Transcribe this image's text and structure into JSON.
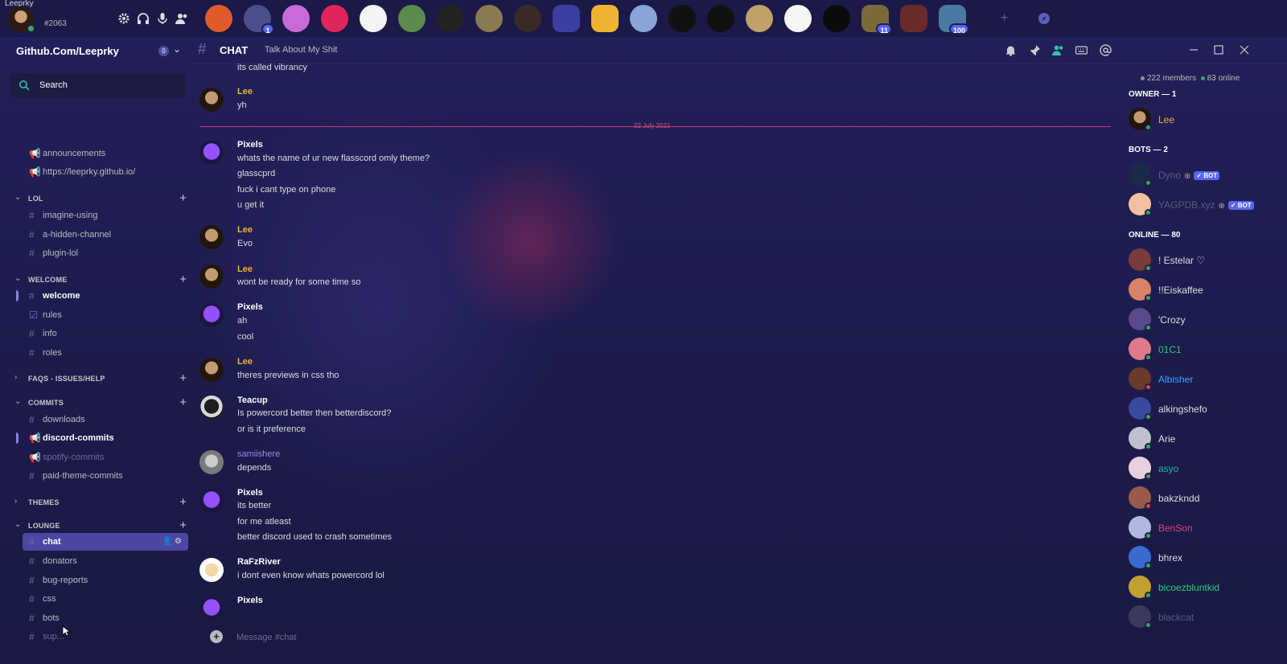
{
  "window": {
    "title": "Leeprky"
  },
  "user": {
    "discriminator": "#2063"
  },
  "servers": [
    {
      "name": "server-sunset",
      "color": "#e05b2b"
    },
    {
      "name": "server-city",
      "color": "#4a4e8a",
      "badge": "1"
    },
    {
      "name": "server-rainbow",
      "color": "#c86bd6"
    },
    {
      "name": "server-pink",
      "color": "#e2245c"
    },
    {
      "name": "server-goose",
      "color": "#f4f4f4"
    },
    {
      "name": "server-frog",
      "color": "#5c8a4a"
    },
    {
      "name": "server-vz",
      "color": "#222222"
    },
    {
      "name": "server-cat",
      "color": "#8a7a52"
    },
    {
      "name": "server-portrait",
      "color": "#3a2a26"
    },
    {
      "name": "server-folder-blue",
      "color": "#3b3f9e"
    },
    {
      "name": "server-folder-yellow",
      "color": "#f0b232"
    },
    {
      "name": "server-stripes",
      "color": "#8aa4d6"
    },
    {
      "name": "server-g1",
      "color": "#111111"
    },
    {
      "name": "server-g2",
      "color": "#111111"
    },
    {
      "name": "server-bird",
      "color": "#c2a06a"
    },
    {
      "name": "server-9l",
      "color": "#f5f5f5"
    },
    {
      "name": "server-binary",
      "color": "#0b0b0b"
    },
    {
      "name": "server-folder-11",
      "color": "#7a6a3a",
      "badge": "11"
    },
    {
      "name": "server-folder-red",
      "color": "#6a2a2a"
    },
    {
      "name": "server-folder-100",
      "color": "#4a7aa0",
      "badge": "100"
    }
  ],
  "sidebar": {
    "server_name": "Github.Com/Leeprky",
    "boost_count": "0",
    "search_label": "Search",
    "top_channels": [
      {
        "name": "announcements"
      },
      {
        "name": "https://leeprky.github.io/"
      }
    ],
    "categories": [
      {
        "name": "LOL",
        "channels": [
          "imagine-using",
          "a-hidden-channel",
          "plugin-lol"
        ]
      },
      {
        "name": "WELCOME",
        "channels": [
          "welcome",
          "rules",
          "info",
          "roles"
        ]
      },
      {
        "name": "FAQS - ISSUES/HELP",
        "channels": []
      },
      {
        "name": "COMMITS",
        "channels": [
          "downloads",
          "discord-commits",
          "spotify-commits",
          "paid-theme-commits"
        ]
      },
      {
        "name": "THEMES",
        "channels": []
      },
      {
        "name": "LOUNGE",
        "channels": [
          "chat",
          "donators",
          "bug-reports",
          "css",
          "bots",
          "sup..."
        ]
      }
    ]
  },
  "header": {
    "channel": "CHAT",
    "topic": "Talk About My Shit"
  },
  "chat": {
    "date_divider": "22 July 2021",
    "messages": [
      {
        "text": "its called vibrancy"
      },
      {
        "author": "Lee",
        "lines": [
          "yh"
        ]
      },
      {
        "author": "Pixels",
        "lines": [
          "whats the name of ur new flasscord omly theme?",
          "glasscprd",
          "fuck i cant type on phone",
          "u get it"
        ]
      },
      {
        "author": "Lee",
        "lines": [
          "Evo"
        ]
      },
      {
        "author": "Lee",
        "lines": [
          "wont be ready for some time so"
        ]
      },
      {
        "author": "Pixels",
        "lines": [
          "ah",
          "cool"
        ]
      },
      {
        "author": "Lee",
        "lines": [
          "theres previews in css tho"
        ]
      },
      {
        "author": "Teacup",
        "lines": [
          "Is powercord better then betterdiscord?",
          "or is it preference"
        ]
      },
      {
        "author": "samiishere",
        "lines": [
          "depends"
        ]
      },
      {
        "author": "Pixels",
        "lines": [
          "its better",
          "for me atleast",
          "better discord used to crash sometimes"
        ]
      },
      {
        "author": "RaFzRiver",
        "lines": [
          "i dont even know whats powercord lol"
        ]
      },
      {
        "author": "Pixels",
        "lines": []
      }
    ],
    "composer_placeholder": "Message #chat"
  },
  "members": {
    "total": "222 members",
    "online": "83 online",
    "groups": [
      {
        "title": "OWNER — 1",
        "members": [
          {
            "name": "Lee",
            "color": "#f0b232",
            "status": "online"
          }
        ]
      },
      {
        "title": "BOTS — 2",
        "members": [
          {
            "name": "Dyno",
            "color": "#5b5d80",
            "status": "online",
            "bot": "✓ BOT"
          },
          {
            "name": "YAGPDB.xyz",
            "color": "#5b5d80",
            "status": "online",
            "bot": "✓ BOT"
          }
        ]
      },
      {
        "title": "ONLINE — 80",
        "members": [
          {
            "name": "! Estelar ♡",
            "color": "#dcddde",
            "status": "online"
          },
          {
            "name": "!!Eiskaffee",
            "color": "#dcddde",
            "status": "online"
          },
          {
            "name": "'Crozy",
            "color": "#dcddde",
            "status": "online"
          },
          {
            "name": "01C1",
            "color": "#2ecc71",
            "status": "online"
          },
          {
            "name": "Albisher",
            "color": "#3aa0ff",
            "status": "dnd"
          },
          {
            "name": "alkingshefo",
            "color": "#dcddde",
            "status": "online"
          },
          {
            "name": "Arie",
            "color": "#dcddde",
            "status": "online"
          },
          {
            "name": "asyo",
            "color": "#1abc9c",
            "status": "online"
          },
          {
            "name": "bakzkndd",
            "color": "#dcddde",
            "status": "dnd"
          },
          {
            "name": "BenSon",
            "color": "#e0457b",
            "status": "online"
          },
          {
            "name": "bhrex",
            "color": "#dcddde",
            "status": "online"
          },
          {
            "name": "bicoezbluntkid",
            "color": "#2ecc71",
            "status": "online"
          },
          {
            "name": "blackcat",
            "color": "#5b5d80",
            "status": "online"
          }
        ]
      }
    ]
  },
  "colors": {
    "accent": "#5865f2",
    "online": "#3ba55d",
    "dnd": "#ed4245",
    "divider": "#c13a70"
  }
}
